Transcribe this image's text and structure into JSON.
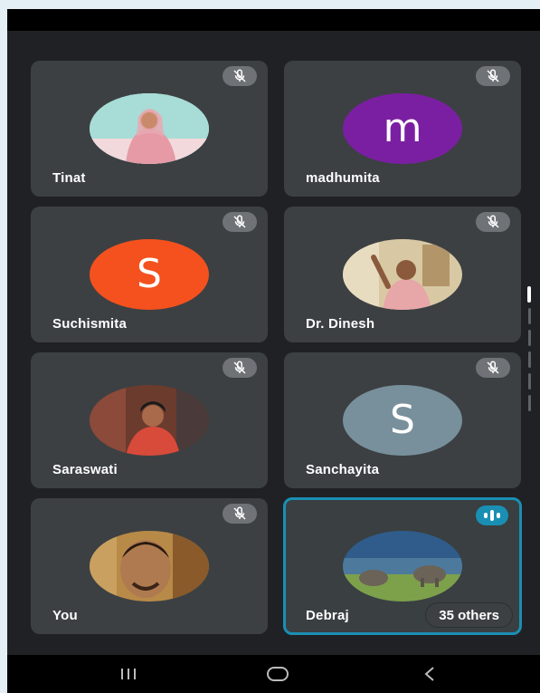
{
  "participants": [
    {
      "name": "Tinat",
      "muted": true,
      "avatar_type": "photo"
    },
    {
      "name": "madhumita",
      "muted": true,
      "avatar_type": "letter",
      "letter": "m",
      "color": "#7b1fa2"
    },
    {
      "name": "Suchismita",
      "muted": true,
      "avatar_type": "letter",
      "letter": "S",
      "color": "#f4511e"
    },
    {
      "name": "Dr. Dinesh",
      "muted": true,
      "avatar_type": "photo"
    },
    {
      "name": "Saraswati",
      "muted": true,
      "avatar_type": "photo"
    },
    {
      "name": "Sanchayita",
      "muted": true,
      "avatar_type": "letter",
      "letter": "S",
      "color": "#78909c"
    },
    {
      "name": "You",
      "muted": true,
      "avatar_type": "photo"
    },
    {
      "name": "Debraj",
      "muted": false,
      "speaking": true,
      "avatar_type": "photo"
    }
  ],
  "others_chip": "35 others",
  "icons": {
    "muted": "mic-off-icon",
    "speaking": "audio-level-icon",
    "nav_recents": "recents-icon",
    "nav_home": "home-icon",
    "nav_back": "back-icon"
  },
  "colors": {
    "background": "#202124",
    "tile": "#3c4043",
    "accent": "#1a8fb4"
  }
}
